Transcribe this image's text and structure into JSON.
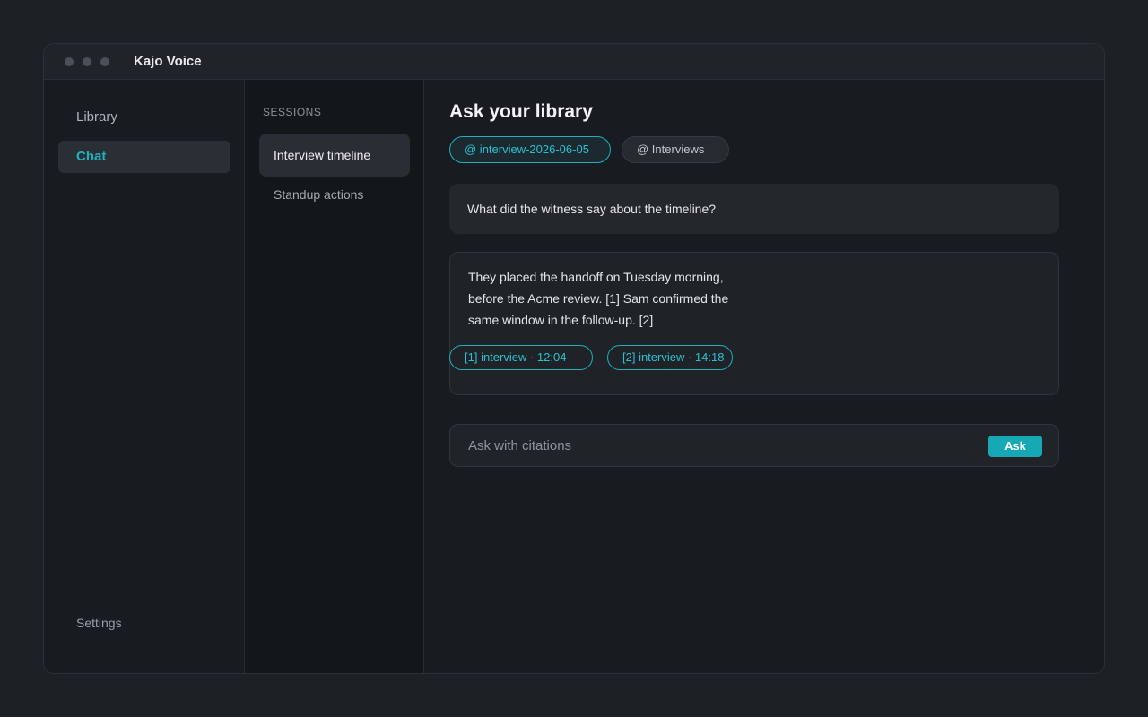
{
  "window": {
    "title": "Kajo Voice"
  },
  "nav": {
    "items": [
      {
        "label": "Library",
        "active": false
      },
      {
        "label": "Chat",
        "active": true
      }
    ],
    "settings_label": "Settings"
  },
  "sessions": {
    "heading": "SESSIONS",
    "items": [
      {
        "label": "Interview timeline",
        "active": true
      },
      {
        "label": "Standup actions",
        "active": false
      }
    ]
  },
  "main": {
    "title": "Ask your library",
    "scope_chips": [
      {
        "label": "@ interview-2026-06-05",
        "selected": true
      },
      {
        "label": "@ Interviews",
        "selected": false
      }
    ],
    "question": "What did the witness say about the timeline?",
    "answer": {
      "text": "They placed the handoff on Tuesday morning, before the Acme review. [1] Sam confirmed the same window in the follow-up. [2]",
      "citations": [
        {
          "label": "[1] interview · 12:04"
        },
        {
          "label": "[2] interview · 14:18"
        }
      ]
    },
    "ask": {
      "placeholder": "Ask with citations",
      "value": "",
      "button_label": "Ask"
    }
  },
  "colors": {
    "accent": "#1fb0c0",
    "background": "#1d2126",
    "surface": "#181b1f"
  }
}
